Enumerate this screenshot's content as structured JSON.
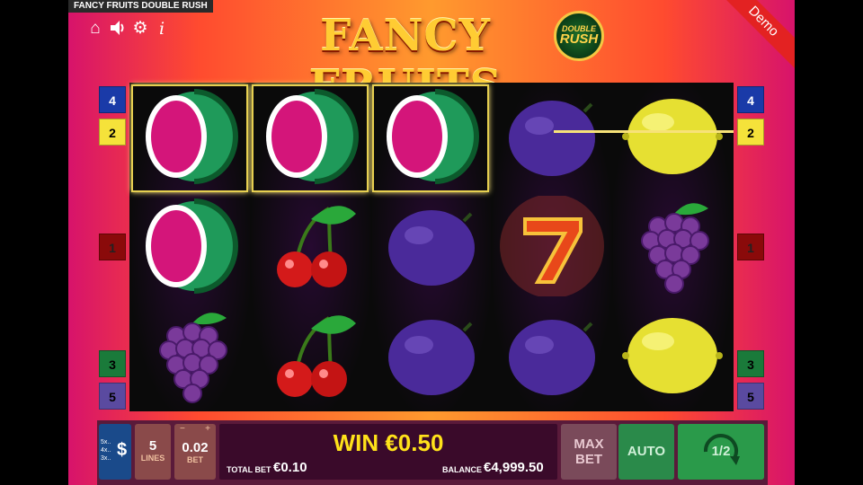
{
  "app": {
    "title": "FANCY FRUITS DOUBLE RUSH",
    "demo_label": "Demo"
  },
  "logo": {
    "main": "FANCY FRUITS",
    "badge_line1": "DOUBLE",
    "badge_line2": "RUSH"
  },
  "icons": [
    "home-icon",
    "speaker-icon",
    "gear-icon",
    "info-icon"
  ],
  "reels": [
    [
      "watermelon",
      "watermelon",
      "grapes"
    ],
    [
      "watermelon",
      "cherries",
      "cherries"
    ],
    [
      "watermelon",
      "plum",
      "plum"
    ],
    [
      "plum",
      "seven",
      "plum"
    ],
    [
      "lemon",
      "grapes",
      "lemon"
    ]
  ],
  "paylines": {
    "left": [
      {
        "label": "4",
        "color": "#1a3aa8"
      },
      {
        "label": "2",
        "color": "#f5e23a"
      },
      {
        "label": "1",
        "color": "#8a0a0a"
      },
      {
        "label": "3",
        "color": "#1a7a3a"
      },
      {
        "label": "5",
        "color": "#5a4aa0"
      }
    ],
    "right": [
      {
        "label": "4",
        "color": "#1a3aa8"
      },
      {
        "label": "2",
        "color": "#f5e23a"
      },
      {
        "label": "1",
        "color": "#8a0a0a"
      },
      {
        "label": "3",
        "color": "#1a7a3a"
      },
      {
        "label": "5",
        "color": "#5a4aa0"
      }
    ]
  },
  "controls": {
    "paytable_lines": [
      "5x..",
      "4x..",
      "3x.."
    ],
    "paytable_symbol": "$",
    "lines_value": "5",
    "lines_label": "LINES",
    "bet_value": "0.02",
    "bet_label": "BET",
    "win_text": "WIN €0.50",
    "total_bet_label": "TOTAL BET",
    "total_bet_value": "€0.10",
    "balance_label": "BALANCE",
    "balance_value": "€4,999.50",
    "max_bet_line1": "MAX",
    "max_bet_line2": "BET",
    "auto_label": "AUTO",
    "spin_label": "1/2"
  }
}
